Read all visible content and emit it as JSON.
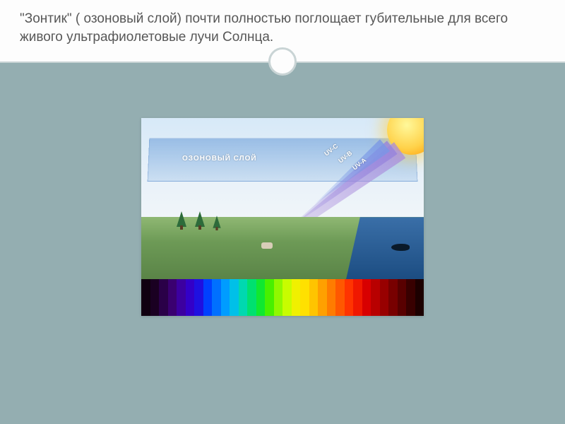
{
  "header": {
    "text": "\"Зонтик\" ( озоновый слой) почти полностью поглощает губительные для всего живого ультрафиолетовые лучи Солнца."
  },
  "diagram": {
    "ozone_label": "ОЗОНОВЫЙ СЛОЙ",
    "rays": {
      "uvc": "UV-C",
      "uvb": "UV-B",
      "uva": "UV-A"
    }
  },
  "spectrum_colors": [
    "#100010",
    "#1a0022",
    "#2a0048",
    "#3a0070",
    "#3c00a0",
    "#3300c8",
    "#1f10e0",
    "#0040ff",
    "#0070ff",
    "#009cff",
    "#00c0e8",
    "#00d8b0",
    "#00e070",
    "#10e830",
    "#48f000",
    "#90f800",
    "#c8fc00",
    "#f0f000",
    "#ffe000",
    "#ffc400",
    "#ffa000",
    "#ff7c00",
    "#ff5800",
    "#ff3400",
    "#f01800",
    "#d80000",
    "#b80000",
    "#980000",
    "#780000",
    "#580000",
    "#380000",
    "#1c0000"
  ]
}
